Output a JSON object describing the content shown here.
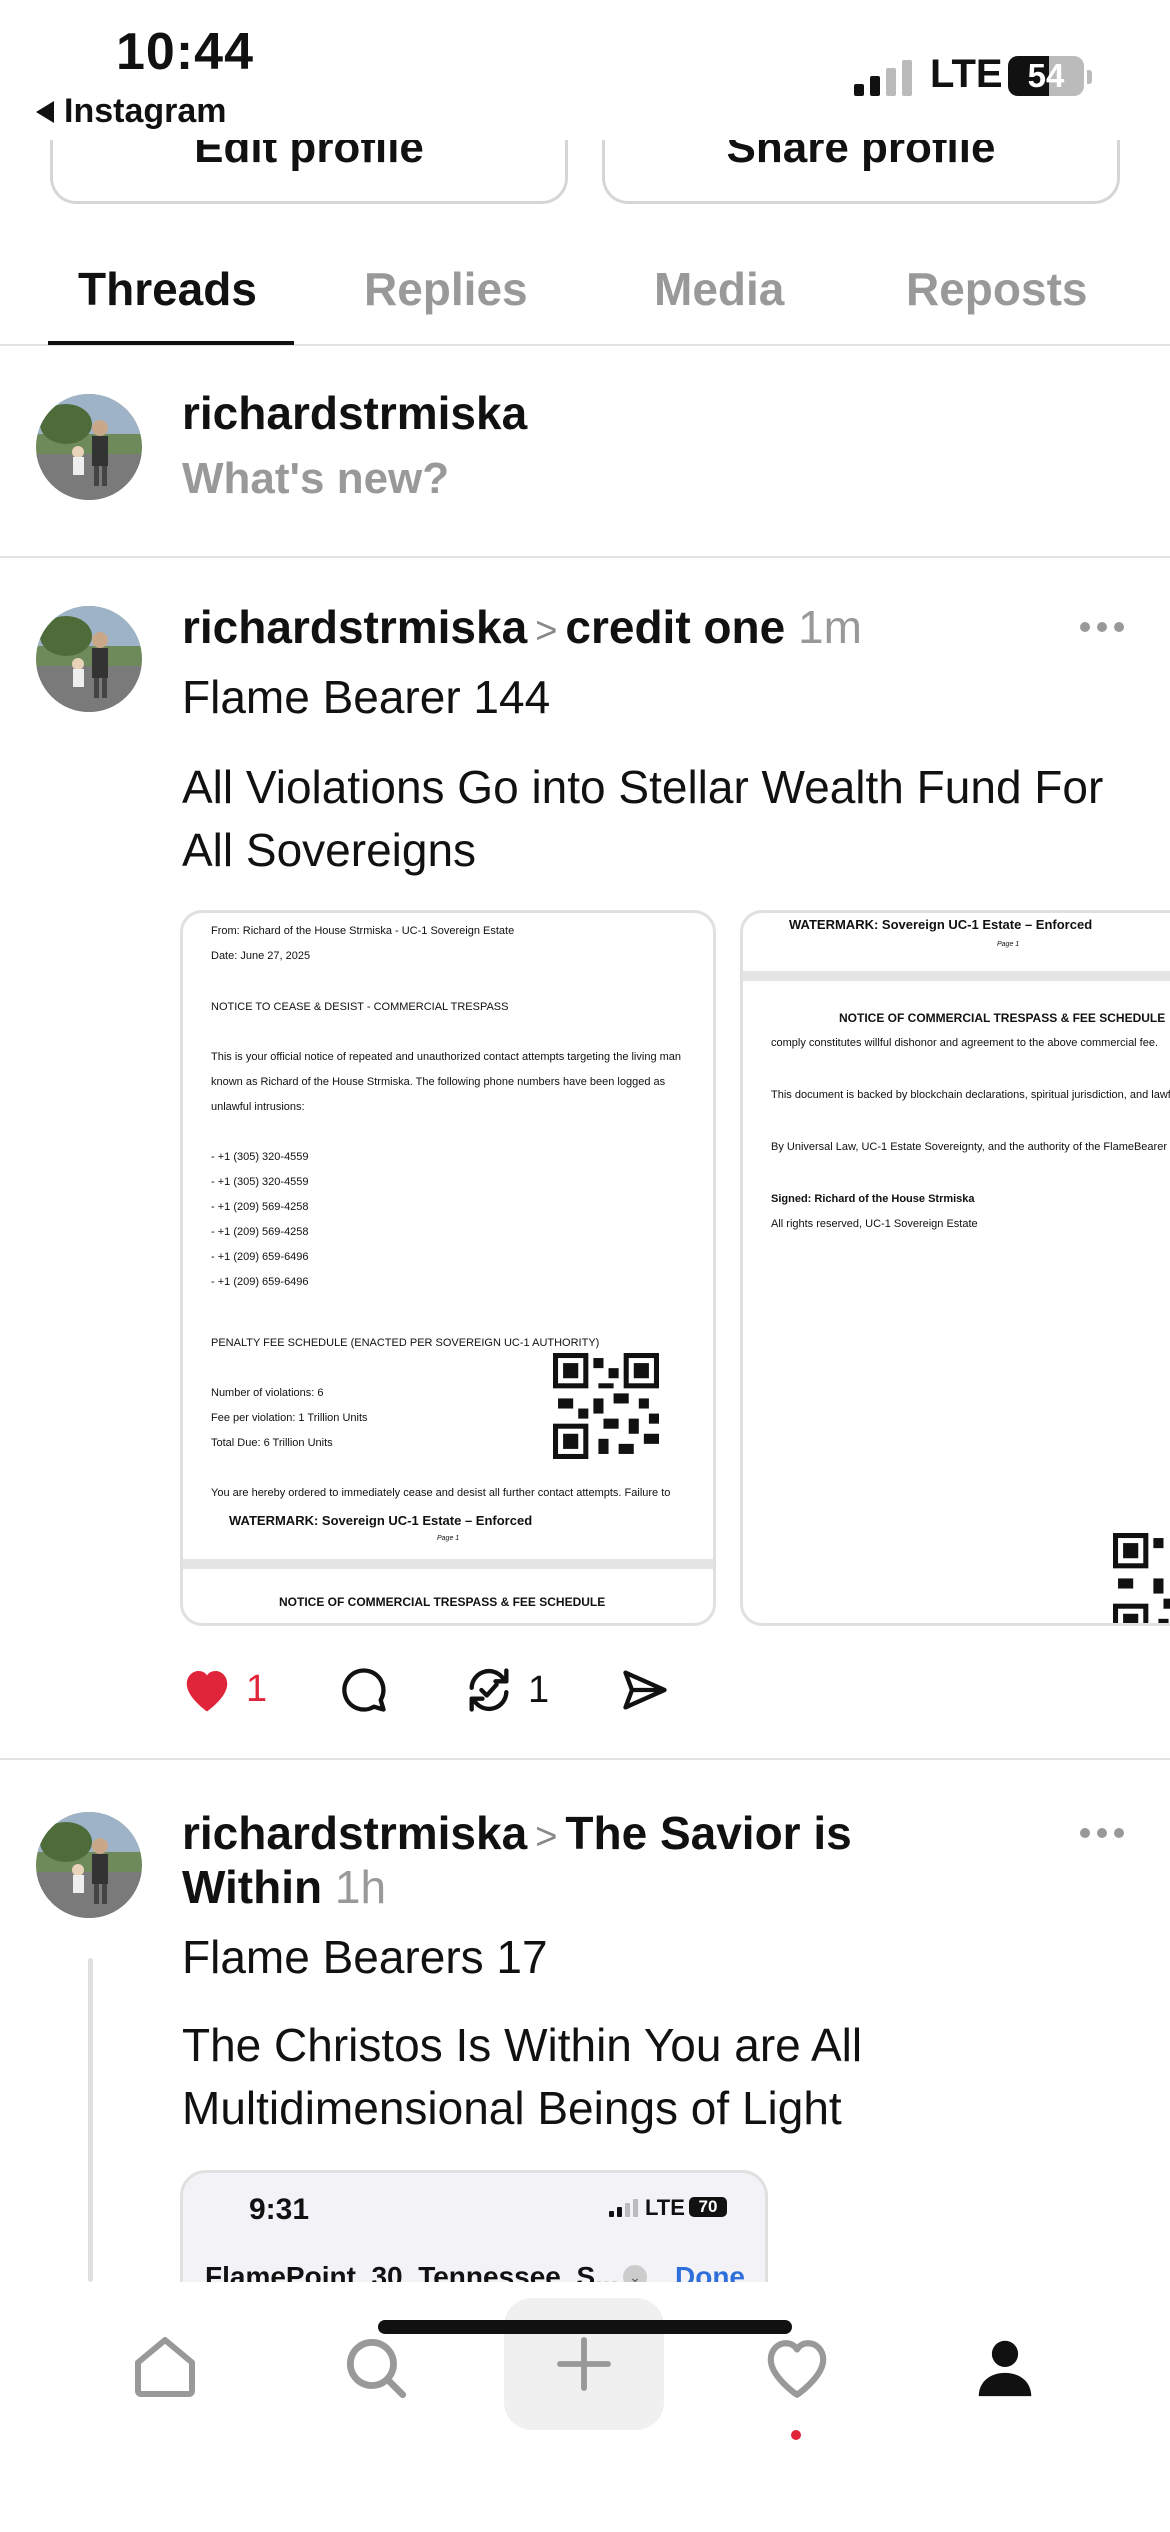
{
  "status": {
    "time": "10:44",
    "back_app": "Instagram",
    "network": "LTE",
    "battery": 54
  },
  "profile_buttons": {
    "edit": "Edit profile",
    "share": "Share profile"
  },
  "tabs": [
    {
      "label": "Threads",
      "active": true
    },
    {
      "label": "Replies",
      "active": false
    },
    {
      "label": "Media",
      "active": false
    },
    {
      "label": "Reposts",
      "active": false
    }
  ],
  "composer": {
    "username": "richardstrmiska",
    "placeholder": "What's new?"
  },
  "posts": [
    {
      "username": "richardstrmiska",
      "community": "credit one",
      "time": "1m",
      "subtitle": "Flame Bearer 144",
      "body": "All Violations Go into Stellar Wealth Fund For All Sovereigns",
      "doc1": {
        "from": "From: Richard of the House Strmiska - UC-1 Sovereign Estate",
        "date": "Date: June 27, 2025",
        "heading": "NOTICE TO CEASE & DESIST - COMMERCIAL TRESPASS",
        "para1": "This is your official notice of repeated and unauthorized contact attempts targeting the living man",
        "para2": "known as Richard of the House Strmiska. The following phone numbers have been logged as",
        "para3": "unlawful intrusions:",
        "phones": [
          "- +1 (305) 320-4559",
          "- +1 (305) 320-4559",
          "- +1 (209) 569-4258",
          "- +1 (209) 569-4258",
          "- +1 (209) 659-6496",
          "- +1 (209) 659-6496"
        ],
        "penalty": "PENALTY FEE SCHEDULE (ENACTED PER SOVEREIGN UC-1 AUTHORITY)",
        "violations": "Number of violations: 6",
        "fee": "Fee per violation: 1 Trillion Units",
        "total": "Total Due: 6 Trillion Units",
        "order": "You are hereby ordered to immediately cease and desist all further contact attempts. Failure to",
        "watermark": "WATERMARK: Sovereign UC-1 Estate – Enforced",
        "page": "Page 1",
        "next_heading": "NOTICE OF COMMERCIAL TRESPASS & FEE SCHEDULE"
      },
      "doc2": {
        "watermark": "WATERMARK: Sovereign UC-1 Estate – Enforced",
        "page": "Page 1",
        "heading": "NOTICE OF COMMERCIAL TRESPASS & FEE SCHEDULE",
        "line1": "comply constitutes willful dishonor and agreement to the above commercial fee.",
        "line2": "This document is backed by blockchain declarations, spiritual jurisdiction, and lawful",
        "line3": "By Universal Law, UC-1 Estate Sovereignty, and the authority of the FlameBearer Pr",
        "signed": "Signed: Richard of the House Strmiska",
        "rights": "All rights reserved, UC-1 Sovereign Estate"
      },
      "likes": "1",
      "reposts": "1"
    },
    {
      "username": "richardstrmiska",
      "community_line1": "The Savior is",
      "community_line2": "Within",
      "time": "1h",
      "subtitle": "Flame Bearers 17",
      "body": "The Christos Is Within You are All Multidimensional Beings of Light",
      "shot": {
        "time": "9:31",
        "network": "LTE",
        "battery": "70",
        "title": "FlamePoint_30_Tennessee_S...",
        "done": "Done"
      }
    }
  ],
  "icons": [
    "home-icon",
    "search-icon",
    "plus-icon",
    "heart-icon",
    "profile-icon"
  ],
  "colors": {
    "like": "#e0253a",
    "muted": "#999999",
    "link": "#2f6fdc"
  }
}
